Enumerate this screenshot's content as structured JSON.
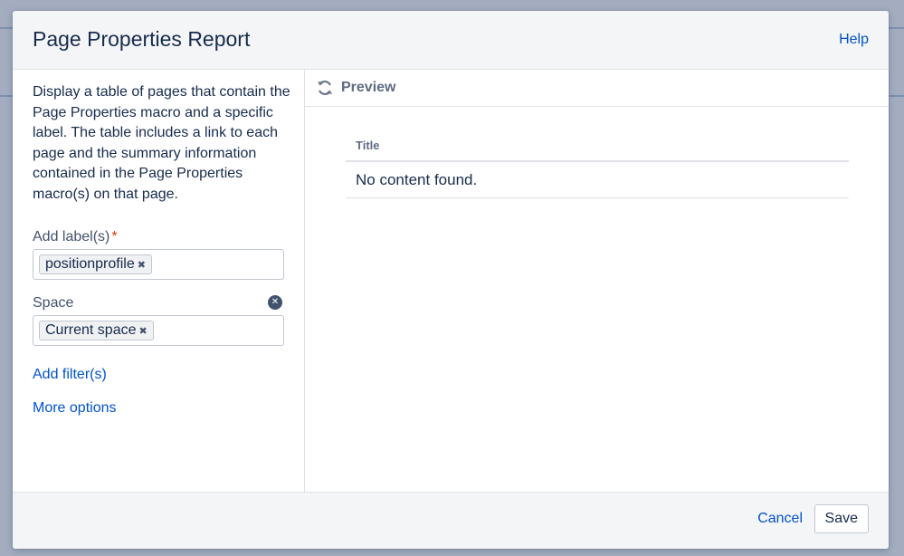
{
  "dialog": {
    "title": "Page Properties Report",
    "help_label": "Help"
  },
  "left": {
    "description": "Display a table of pages that contain the Page Properties macro and a specific label. The table includes a link to each page and the summary information contained in the Page Properties macro(s) on that page.",
    "labels_field": {
      "label": "Add label(s)",
      "required_mark": "*",
      "chip": "positionprofile"
    },
    "space_field": {
      "label": "Space",
      "chip": "Current space"
    },
    "add_filters_label": "Add filter(s)",
    "more_options_label": "More options"
  },
  "preview": {
    "label": "Preview",
    "table": {
      "header": "Title",
      "empty_message": "No content found."
    }
  },
  "footer": {
    "cancel_label": "Cancel",
    "save_label": "Save"
  },
  "colors": {
    "accent": "#0052cc",
    "required": "#de350b"
  }
}
